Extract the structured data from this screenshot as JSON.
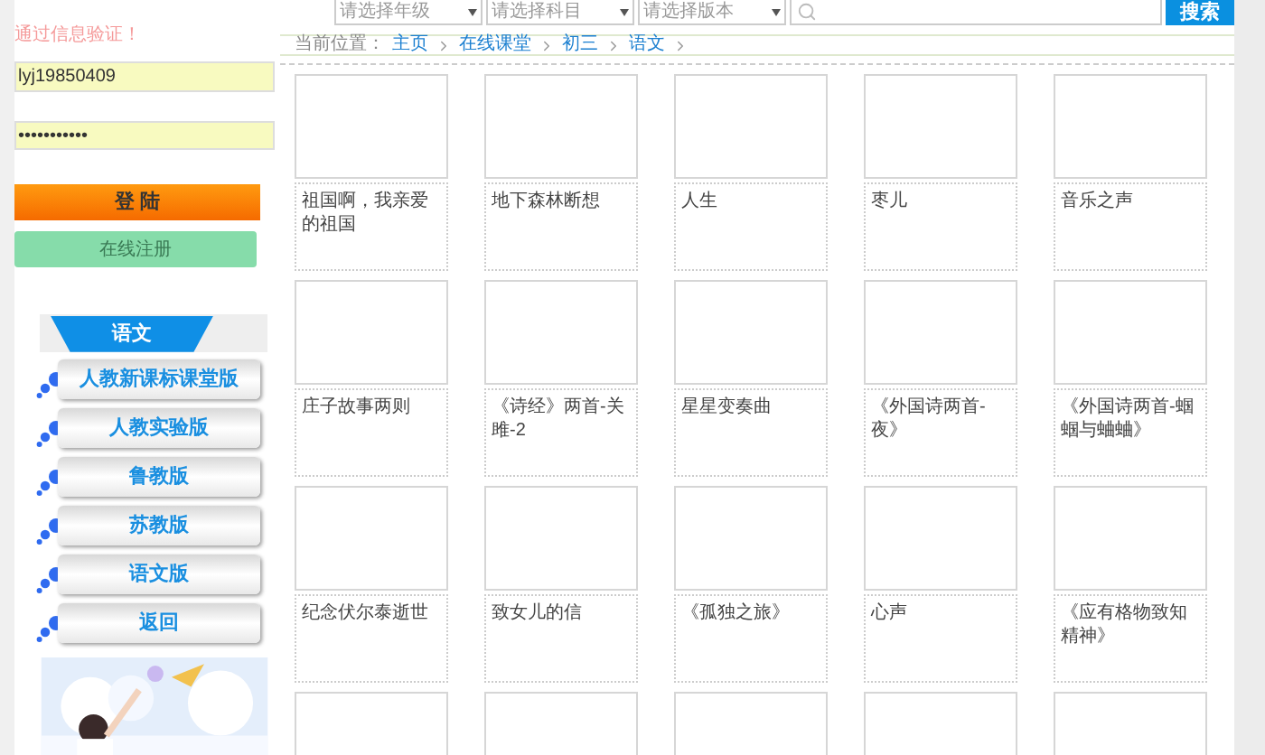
{
  "login": {
    "notice": "通过信息验证！",
    "username": "lyj19850409",
    "password": "•••••••••••",
    "login_button": "登 陆",
    "register_button": "在线注册"
  },
  "subject_panel": {
    "title": "语文",
    "items": [
      {
        "label": "人教新课标课堂版"
      },
      {
        "label": "人教实验版"
      },
      {
        "label": "鲁教版"
      },
      {
        "label": "苏教版"
      },
      {
        "label": "语文版"
      },
      {
        "label": "返回"
      }
    ]
  },
  "filters": [
    {
      "placeholder": "请选择年级"
    },
    {
      "placeholder": "请选择科目"
    },
    {
      "placeholder": "请选择版本"
    }
  ],
  "search": {
    "button": "搜索"
  },
  "breadcrumb": {
    "label": "当前位置：",
    "links": [
      "主页",
      "在线课堂",
      "初三",
      "语文"
    ]
  },
  "lessons": [
    {
      "title": "祖国啊，我亲爱的祖国"
    },
    {
      "title": "地下森林断想"
    },
    {
      "title": "人生"
    },
    {
      "title": "枣儿"
    },
    {
      "title": "音乐之声"
    },
    {
      "title": "庄子故事两则"
    },
    {
      "title": "《诗经》两首-关雎-2"
    },
    {
      "title": "星星变奏曲"
    },
    {
      "title": "《外国诗两首-夜》"
    },
    {
      "title": "《外国诗两首-蝈蝈与蛐蛐》"
    },
    {
      "title": "纪念伏尔泰逝世"
    },
    {
      "title": "致女儿的信"
    },
    {
      "title": "《孤独之旅》"
    },
    {
      "title": "心声"
    },
    {
      "title": "《应有格物致知精神》"
    }
  ]
}
